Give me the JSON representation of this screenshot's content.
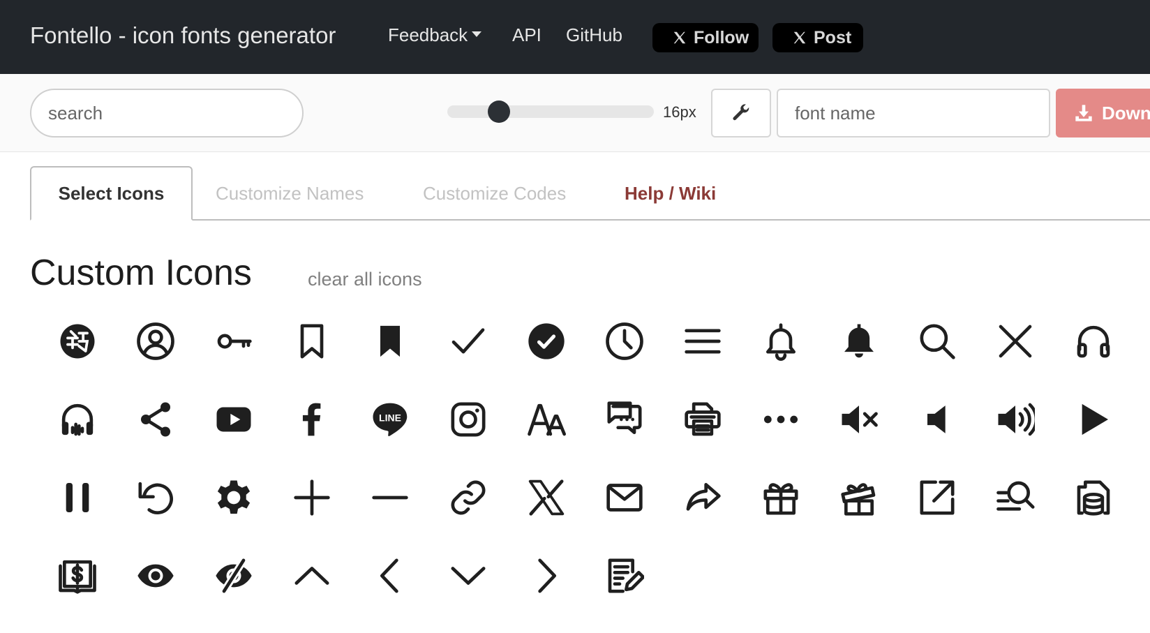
{
  "navbar": {
    "brand": "Fontello - icon fonts generator",
    "links": {
      "feedback": "Feedback",
      "api": "API",
      "github": "GitHub"
    },
    "social": {
      "follow": "Follow",
      "post": "Post"
    }
  },
  "toolbar": {
    "search_placeholder": "search",
    "size_label": "16px",
    "size_slider_fraction": 0.25,
    "font_name_placeholder": "font name",
    "download_label": "Down"
  },
  "tabs": {
    "select_icons": "Select Icons",
    "customize_names": "Customize Names",
    "customize_codes": "Customize Codes",
    "help_wiki": "Help / Wiki"
  },
  "section": {
    "title": "Custom Icons",
    "clear_all": "clear all icons"
  },
  "icons": [
    "chinese-character-icon",
    "user-circle-icon",
    "key-icon",
    "bookmark-outline-icon",
    "bookmark-solid-icon",
    "check-icon",
    "check-circle-icon",
    "clock-icon",
    "menu-icon",
    "bell-outline-icon",
    "bell-solid-icon",
    "search-icon",
    "close-icon",
    "headphones-outline-icon",
    "headphones-audio-icon",
    "share-icon",
    "youtube-icon",
    "facebook-icon",
    "line-icon",
    "instagram-icon",
    "font-size-icon",
    "chat-icon",
    "printer-icon",
    "ellipsis-icon",
    "volume-mute-icon",
    "volume-off-icon",
    "volume-up-icon",
    "play-icon",
    "pause-icon",
    "undo-icon",
    "gear-icon",
    "plus-icon",
    "minus-icon",
    "link-icon",
    "x-logo-icon",
    "mail-icon",
    "share-arrow-icon",
    "gift-icon",
    "gift-open-icon",
    "external-link-icon",
    "list-search-icon",
    "database-file-icon",
    "book-dollar-icon",
    "eye-icon",
    "eye-off-icon",
    "chevron-up-icon",
    "chevron-left-icon",
    "chevron-down-icon",
    "chevron-right-icon",
    "edit-document-icon"
  ],
  "colors": {
    "navbar_bg": "#22262b",
    "download_bg": "#e48a88",
    "help_link": "#8b3a36",
    "icon": "#1f1f1f"
  }
}
